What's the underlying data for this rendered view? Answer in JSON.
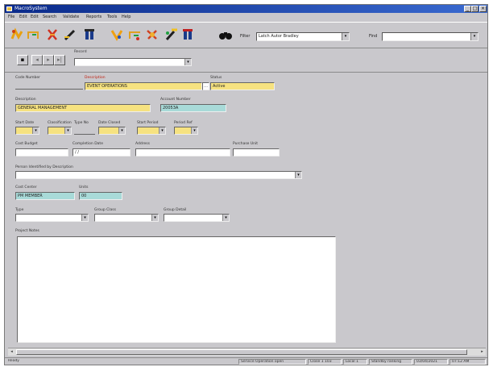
{
  "window": {
    "title": "MacroSystem"
  },
  "menu": [
    "File",
    "Edit",
    "Edit",
    "Search",
    "Validate",
    "Reports",
    "Tools",
    "Help"
  ],
  "toolbar": {
    "filter_label": "Filter",
    "filter_value": "Latch   Autor Bradley",
    "find_label": "Find",
    "find_value": ""
  },
  "nav": {
    "record_label": "Record",
    "record_value": ""
  },
  "form": {
    "f1": {
      "label": "Code Number",
      "value": ""
    },
    "f2": {
      "label": "Description",
      "value": "EVENT OPERATIONS"
    },
    "f3": {
      "label": "Status",
      "value": "Active"
    },
    "f4": {
      "label": "Description",
      "value": "GENERAL MANAGEMENT"
    },
    "f5": {
      "label": "Account Number",
      "value": "20053A"
    },
    "f6": {
      "label": "Start Date",
      "value": ""
    },
    "f7": {
      "label": "Classification",
      "value": ""
    },
    "f8": {
      "label": "Type No",
      "value": ""
    },
    "f9": {
      "label": "Date Closed",
      "value": ""
    },
    "f10": {
      "label": "Start Period",
      "value": ""
    },
    "f11": {
      "label": "Period Ref",
      "value": ""
    },
    "f12": {
      "label": "Cost Budget",
      "value": ""
    },
    "f13": {
      "label": "Completion Date",
      "value": "/ /"
    },
    "f14": {
      "label": "Address",
      "value": ""
    },
    "f15": {
      "label": "Purchase Unit",
      "value": ""
    },
    "f16": {
      "label": "Person Identified by Description",
      "value": ""
    },
    "f17": {
      "label": "Cost Center",
      "value": "PM MEMBER"
    },
    "f18": {
      "label": "Units",
      "value": "00"
    },
    "f19": {
      "label": "Type",
      "value": ""
    },
    "f20": {
      "label": "Group Class",
      "value": ""
    },
    "f21": {
      "label": "Group Detail",
      "value": ""
    },
    "notes": {
      "label": "Project Notes"
    }
  },
  "status": [
    "Ready",
    "Service Operation open",
    "Close 1  103",
    "Local 1",
    "Standby ranking",
    "03/04/2021",
    "07:12 AM"
  ]
}
